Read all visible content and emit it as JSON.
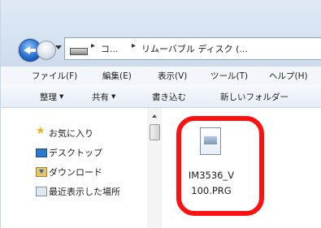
{
  "address_bar": {
    "crumbs": [
      "コ...",
      "リムーバブル ディスク (..."
    ],
    "separator": "▸"
  },
  "menu": {
    "items": [
      "ファイル(F)",
      "編集(E)",
      "表示(V)",
      "ツール(T)",
      "ヘルプ(H)"
    ]
  },
  "toolbar": {
    "organize": "整理",
    "share": "共有",
    "burn": "書き込む",
    "new_folder": "新しいフォルダー",
    "arrow": "▼"
  },
  "nav_pane": {
    "favorites": "お気に入り",
    "desktop": "デスクトップ",
    "downloads": "ダウンロード",
    "recent": "最近表示した場所"
  },
  "file": {
    "name_line1": "IM3536_V",
    "name_line2": "100.PRG"
  },
  "colors": {
    "highlight": "#ff1010",
    "accent": "#2a70d0"
  }
}
